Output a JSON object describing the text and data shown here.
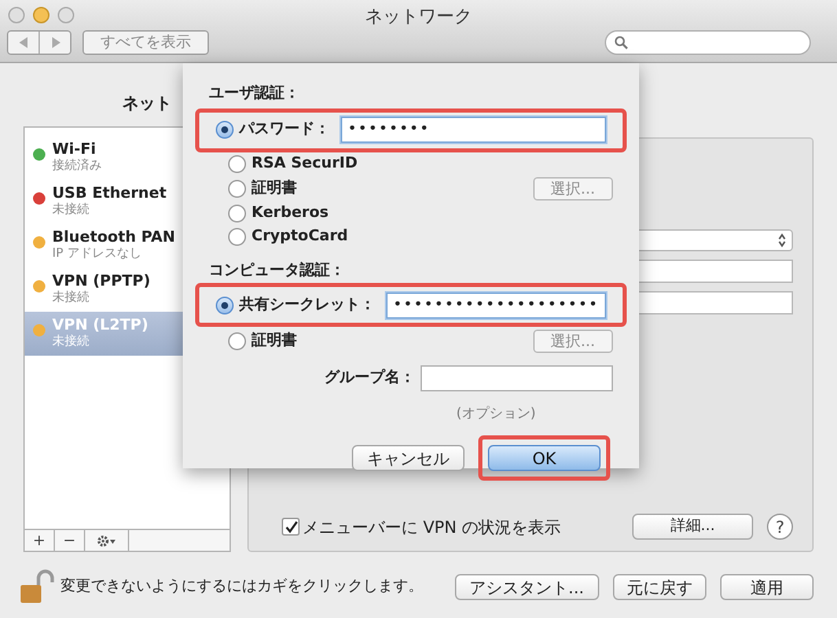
{
  "window": {
    "title": "ネットワーク"
  },
  "toolbar": {
    "show_all": "すべてを表示"
  },
  "network_label": "ネット",
  "sidebar": {
    "items": [
      {
        "name": "Wi-Fi",
        "status": "接続済み",
        "color": "#4caf50",
        "selected": false
      },
      {
        "name": "USB Ethernet",
        "status": "未接続",
        "color": "#d9403a",
        "selected": false
      },
      {
        "name": "Bluetooth PAN",
        "status": "IP アドレスなし",
        "color": "#f0b040",
        "selected": false
      },
      {
        "name": "VPN (PPTP)",
        "status": "未接続",
        "color": "#f0b040",
        "selected": false
      },
      {
        "name": "VPN (L2TP)",
        "status": "未接続",
        "color": "#f0b040",
        "selected": true
      }
    ]
  },
  "sidebar_controls": [
    "+",
    "−"
  ],
  "status_checkbox": {
    "label": "メニューバーに VPN の状況を表示",
    "checked": true
  },
  "advanced_button": "詳細...",
  "help": "?",
  "lock_text": "変更できないようにするにはカギをクリックします。",
  "buttons": [
    "アシスタント...",
    "元に戻す",
    "適用"
  ],
  "sheet": {
    "user_auth": {
      "heading": "ユーザ認証：",
      "options": [
        {
          "label": "パスワード：",
          "selected": true,
          "kind": "secret",
          "value": "••••••••",
          "highlighted": true
        },
        {
          "label": "RSA SecurID",
          "selected": false,
          "kind": "plain"
        },
        {
          "label": "証明書",
          "selected": false,
          "kind": "select",
          "button": "選択..."
        },
        {
          "label": "Kerberos",
          "selected": false,
          "kind": "plain"
        },
        {
          "label": "CryptoCard",
          "selected": false,
          "kind": "plain"
        }
      ]
    },
    "computer_auth": {
      "heading": "コンピュータ認証：",
      "options": [
        {
          "label": "共有シークレット：",
          "selected": true,
          "kind": "secret",
          "value": "••••••••••••••••••••",
          "highlighted": true
        },
        {
          "label": "証明書",
          "selected": false,
          "kind": "select",
          "button": "選択..."
        }
      ]
    },
    "group": {
      "label": "グループ名：",
      "hint": "(オプション)"
    },
    "cancel": "キャンセル",
    "ok": {
      "label": "OK",
      "highlighted": true
    }
  }
}
